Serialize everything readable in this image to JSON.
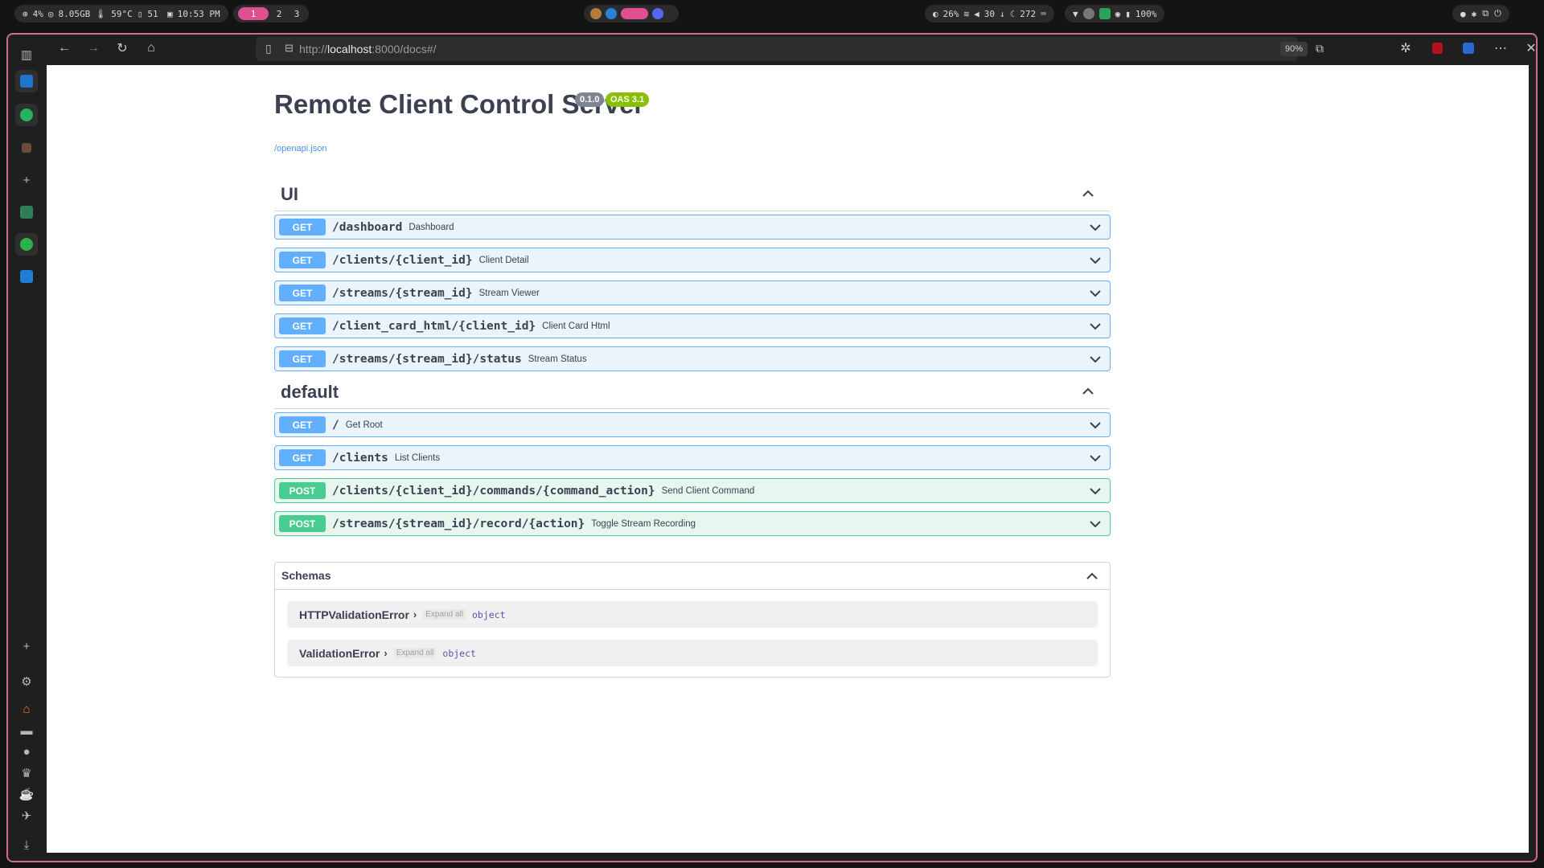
{
  "system_bar": {
    "cpu": "4%",
    "ram": "8.05GB",
    "temp_cpu": "59°C",
    "temp_gpu": "51°C",
    "clock": "10:53 PM",
    "workspaces": [
      "1",
      "2",
      "3"
    ],
    "active_workspace": "1",
    "brightness": "26%",
    "volume": "30",
    "download_count": "272",
    "battery": "100%"
  },
  "browser": {
    "url_prefix": "http://",
    "url_host": "localhost",
    "url_rest": ":8000/docs#/",
    "zoom": "90%"
  },
  "page": {
    "title": "Remote Client Control Server",
    "version": "0.1.0",
    "oas": "OAS 3.1",
    "openapi_link": "/openapi.json",
    "sections": [
      {
        "name": "UI",
        "ops": [
          {
            "method": "GET",
            "path": "/dashboard",
            "summary": "Dashboard"
          },
          {
            "method": "GET",
            "path": "/clients/{client_id}",
            "summary": "Client Detail"
          },
          {
            "method": "GET",
            "path": "/streams/{stream_id}",
            "summary": "Stream Viewer"
          },
          {
            "method": "GET",
            "path": "/client_card_html/{client_id}",
            "summary": "Client Card Html"
          },
          {
            "method": "GET",
            "path": "/streams/{stream_id}/status",
            "summary": "Stream Status"
          }
        ]
      },
      {
        "name": "default",
        "ops": [
          {
            "method": "GET",
            "path": "/",
            "summary": "Get Root"
          },
          {
            "method": "GET",
            "path": "/clients",
            "summary": "List Clients"
          },
          {
            "method": "POST",
            "path": "/clients/{client_id}/commands/{command_action}",
            "summary": "Send Client Command"
          },
          {
            "method": "POST",
            "path": "/streams/{stream_id}/record/{action}",
            "summary": "Toggle Stream Recording"
          }
        ]
      }
    ],
    "schemas": {
      "title": "Schemas",
      "models": [
        {
          "name": "HTTPValidationError",
          "expand": "Expand all",
          "type": "object"
        },
        {
          "name": "ValidationError",
          "expand": "Expand all",
          "type": "object"
        }
      ]
    }
  }
}
